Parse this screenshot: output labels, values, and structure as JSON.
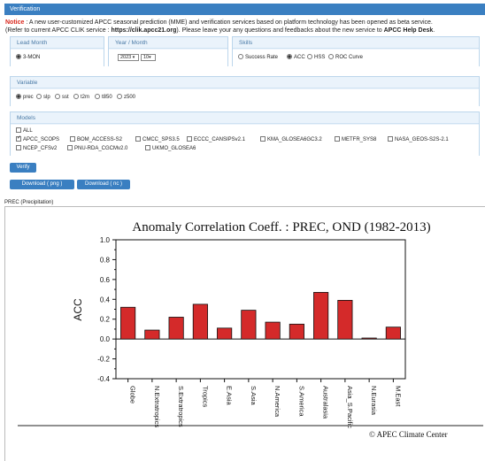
{
  "header": {
    "title": "Verification"
  },
  "notice": {
    "label": "Notice",
    "line1_rest": " : A new user-customized APCC seasonal prediction (MME) and verification services based on platform technology has been opened as beta service.",
    "line2_pre": "(Refer to current APCC CLIK service : ",
    "line2_url": "https://clik.apcc21.org",
    "line2_mid": "). Please leave your any questions and feedbacks about the new service to ",
    "line2_desk": "APCC Help Desk",
    "line2_end": "."
  },
  "lead_month": {
    "label": "Lead Month",
    "option": "3-MON"
  },
  "year_month": {
    "label": "Year / Month",
    "year": "2023",
    "month": "10"
  },
  "skills": {
    "label": "Skills",
    "options": [
      "Success Rate",
      "ACC",
      "HSS",
      "ROC Curve"
    ],
    "selected": "ACC"
  },
  "variable": {
    "label": "Variable",
    "options": [
      "prec",
      "slp",
      "sst",
      "t2m",
      "t850",
      "z500"
    ],
    "selected": "prec"
  },
  "models": {
    "label": "Models",
    "all_label": "ALL",
    "row1": [
      "APCC_SCOPS",
      "BOM_ACCESS-S2",
      "CMCC_SPS3.5",
      "ECCC_CANSIPSv2.1",
      "KMA_GLOSEA6GC3.2",
      "METFR_SYS8",
      "NASA_GEOS-S2S-2.1"
    ],
    "row2": [
      "NCEP_CFSv2",
      "PNU-RDA_CGCMv2.0",
      "UKMO_GLOSEA6"
    ],
    "checked": [
      "APCC_SCOPS"
    ]
  },
  "buttons": {
    "verify": "Verify",
    "download_png": "Download ( png )",
    "download_nc": "Download ( nc )"
  },
  "result": {
    "section_label": "PREC (Precipitation)",
    "copyright": "© APEC Climate Center"
  },
  "chart_data": {
    "type": "bar",
    "title": "Anomaly Correlation Coeff. : PREC, OND (1982-2013)",
    "xlabel": "",
    "ylabel": "ACC",
    "ylim": [
      -0.4,
      1.0
    ],
    "yticks": [
      -0.4,
      -0.2,
      0.0,
      0.2,
      0.4,
      0.6,
      0.8,
      1.0
    ],
    "ytick_labels": [
      "-0.4",
      "-0.2",
      "0.0",
      "0.2",
      "0.4",
      "0.6",
      "0.8",
      "1.0"
    ],
    "grid": false,
    "bar_color": "#d42a2a",
    "categories": [
      "Globe",
      "N.Extratropics",
      "S.Extratropics",
      "Tropics",
      "E.Asia",
      "S.Asia",
      "N.America",
      "S.America",
      "Australasia",
      "Asia_S.Pacific",
      "N.Eurasia",
      "M.East"
    ],
    "values": [
      0.32,
      0.09,
      0.22,
      0.35,
      0.11,
      0.29,
      0.17,
      0.15,
      0.47,
      0.39,
      0.01,
      0.12
    ]
  }
}
